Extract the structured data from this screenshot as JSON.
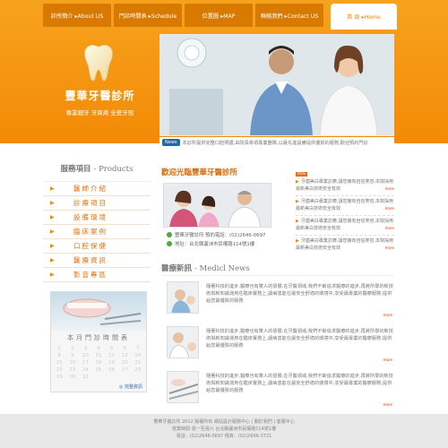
{
  "nav": {
    "items": [
      {
        "label": "診所簡介 ▸About US"
      },
      {
        "label": "門診時間表 ▸Schedule"
      },
      {
        "label": "位置圖 ▸MAP"
      },
      {
        "label": "聯絡我們 ▸Contact US"
      }
    ],
    "home_label": "首 頁 ▸Home"
  },
  "brand": {
    "name": "豐華牙醫診所",
    "slogan": "專業細牙  牙周病  全瓷牙冠"
  },
  "hero_news": {
    "badge": "News",
    "text": "本診所提供完整口腔照護,由院長率領專業團隊,以最先進設備提供優質的服務,歡迎預約門診"
  },
  "services": {
    "title": "服務項目",
    "title_en": "- Products",
    "items": [
      {
        "label": "醫師介紹"
      },
      {
        "label": "診療項目"
      },
      {
        "label": "設備環境"
      },
      {
        "label": "臨床案例"
      },
      {
        "label": "口腔保健"
      },
      {
        "label": "醫療資訊"
      },
      {
        "label": "影音專區"
      }
    ]
  },
  "calendar": {
    "title": "本月門診時間表",
    "days": [
      "1",
      "2",
      "3",
      "4",
      "5",
      "6",
      "7",
      "8",
      "9",
      "10",
      "11",
      "12",
      "13",
      "14",
      "15",
      "16",
      "17",
      "18",
      "19",
      "20",
      "21",
      "22",
      "23",
      "24",
      "25",
      "26",
      "27",
      "28",
      "29",
      "30",
      "31"
    ],
    "more": "完整資訊"
  },
  "welcome": {
    "title": "歡迎光臨豐華牙醫診所",
    "phone": "豐華牙醫診所 預約電話：(02)2646-0697",
    "address": "地址：台北縣蘆洲市民權路114號1樓"
  },
  "rss_badge": "RSS",
  "news_items": [
    {
      "text": "牙齒美白專業診療,讓您擁有自信笑容,本院採用最新美白技術安全有效",
      "more": "more"
    },
    {
      "text": "牙齒美白專業診療,讓您擁有自信笑容,本院採用最新美白技術安全有效",
      "more": "more"
    },
    {
      "text": "牙齒美白專業診療,讓您擁有自信笑容,本院採用最新美白技術安全有效",
      "more": "more"
    },
    {
      "text": "牙齒美白專業診療,讓您擁有自信笑容,本院採用最新美白技術安全有效",
      "more": "more"
    }
  ],
  "medical_news": {
    "title": "醫療新訊",
    "title_en": "- Medicl News",
    "items": [
      {
        "text": "隨著科技的進步,醫療也有驚人的發展,在牙醫領域,我們不斷追求醫療的進步,再將所學的新技術與新知識運用在臨床實務上,讓病患能在最安全舒適的環境中,享受最專業的醫療服務,提供給您最優質的服務",
        "more": "more"
      },
      {
        "text": "隨著科技的進步,醫療也有驚人的發展,在牙醫領域,我們不斷追求醫療的進步,再將所學的新技術與新知識運用在臨床實務上,讓病患能在最安全舒適的環境中,享受最專業的醫療服務,提供給您最優質的服務",
        "more": "more"
      },
      {
        "text": "隨著科技的進步,醫療也有驚人的發展,在牙醫領域,我們不斷追求醫療的進步,再將所學的新技術與新知識運用在臨床實務上,讓病患能在最安全舒適的環境中,享受最專業的醫療服務,提供給您最優質的服務",
        "more": "more"
      }
    ]
  },
  "footer": {
    "line1": "豐華牙醫診所 2012 版權所有 網站設計服務中心 | 關於我們 | 客服中心",
    "line2": "營業時間 週一至週六 台北縣蘆洲市民權路114號1樓",
    "line3": "電話：(02)2646-0697  傳真：(02)2646-3721"
  },
  "colors": {
    "accent": "#f38a05",
    "title": "#d86b0a",
    "link": "#2a6fb0"
  }
}
